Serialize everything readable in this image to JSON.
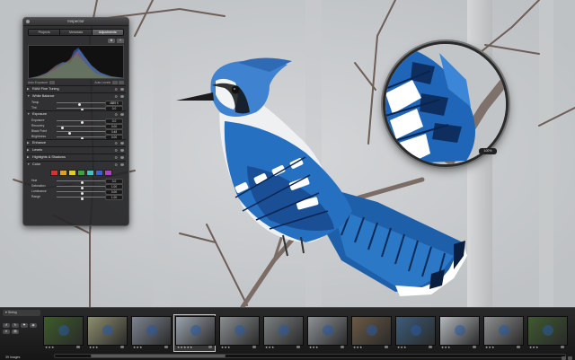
{
  "hud": {
    "title": "Inspector",
    "tabs": [
      {
        "label": "Projects",
        "active": false
      },
      {
        "label": "Metadata",
        "active": false
      },
      {
        "label": "Adjustments",
        "active": true
      }
    ],
    "auto_exposure": "Auto Exposure",
    "auto_levels": "Auto Levels",
    "raw_tuning": "RAW Fine Tuning",
    "white_balance": {
      "label": "White Balance",
      "rows": [
        {
          "label": "Temp",
          "value": "4889 K",
          "pos": 0.45
        },
        {
          "label": "Tint",
          "value": "0.0",
          "pos": 0.5
        }
      ]
    },
    "exposure": {
      "label": "Exposure",
      "rows": [
        {
          "label": "Exposure",
          "value": "0.0",
          "pos": 0.5
        },
        {
          "label": "Recovery",
          "value": "0.00",
          "pos": 0.1
        },
        {
          "label": "Black Point",
          "value": "3.48",
          "pos": 0.25
        },
        {
          "label": "Brightness",
          "value": "0.00",
          "pos": 0.5
        }
      ]
    },
    "sections": [
      "Enhance",
      "Levels",
      "Highlights & Shadows"
    ],
    "color": {
      "label": "Color",
      "swatches": [
        "#d93030",
        "#e0a020",
        "#e0d020",
        "#40a040",
        "#40c0c0",
        "#4060d0",
        "#b040c0"
      ],
      "rows": [
        {
          "label": "Hue",
          "value": "0.0",
          "pos": 0.5
        },
        {
          "label": "Saturation",
          "value": "1.00",
          "pos": 0.5
        },
        {
          "label": "Luminance",
          "value": "0.00",
          "pos": 0.5
        },
        {
          "label": "Range",
          "value": "1.00",
          "pos": 0.5
        }
      ]
    }
  },
  "loupe": {
    "zoom": "100%"
  },
  "browser": {
    "project": "Skiing",
    "image_count": "39 Images",
    "thumbs": [
      {
        "stars": "★★★",
        "color": "#3d5d2a",
        "selected": false
      },
      {
        "stars": "★★★",
        "color": "#8e8e6e",
        "selected": false
      },
      {
        "stars": "★★★",
        "color": "#7d8390",
        "selected": false
      },
      {
        "stars": "★★★★★",
        "color": "#9aa3ad",
        "selected": true
      },
      {
        "stars": "★★★",
        "color": "#8a8f92",
        "selected": false
      },
      {
        "stars": "★★★",
        "color": "#7a7f80",
        "selected": false
      },
      {
        "stars": "★★★",
        "color": "#8d9296",
        "selected": false
      },
      {
        "stars": "★★★",
        "color": "#6a5a45",
        "selected": false
      },
      {
        "stars": "★★★",
        "color": "#3d5d7a",
        "selected": false
      },
      {
        "stars": "★★★",
        "color": "#b5b9bd",
        "selected": false
      },
      {
        "stars": "★★★",
        "color": "#8d8f90",
        "selected": false
      },
      {
        "stars": "★★★",
        "color": "#3f5a30",
        "selected": false
      }
    ]
  }
}
